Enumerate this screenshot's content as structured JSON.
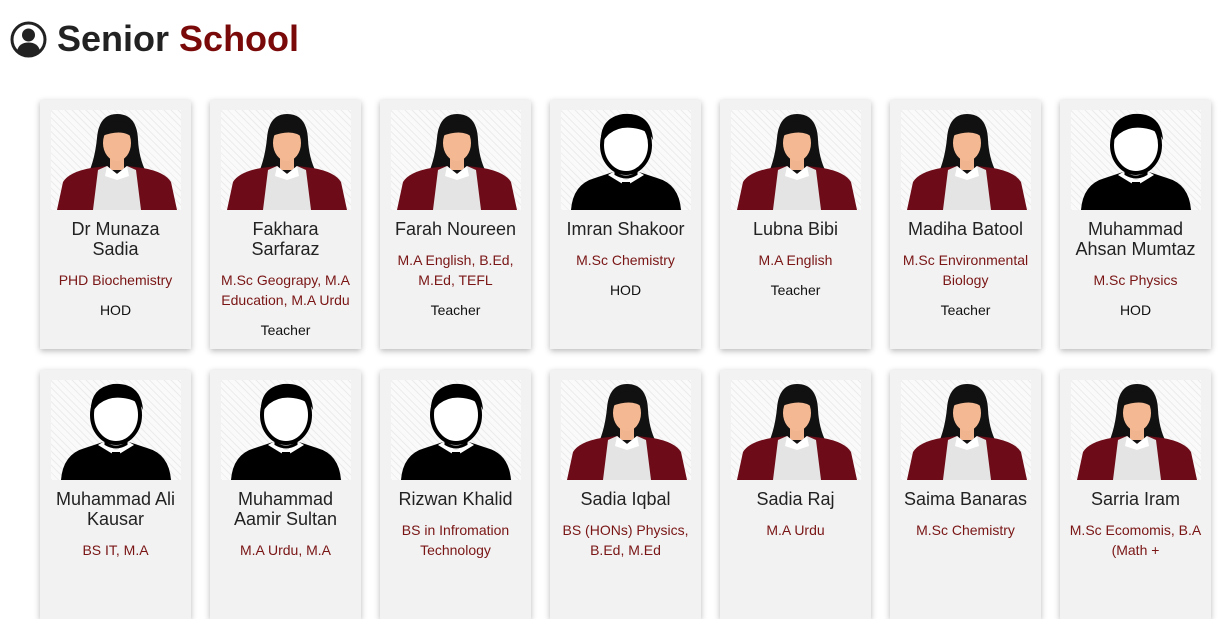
{
  "header": {
    "title_word1": "Senior",
    "title_word2": "School",
    "icon": "user-circle-icon",
    "accent_color": "#7a0a0a"
  },
  "staff": [
    {
      "name": "Dr Munaza Sadia",
      "qualification": "PHD Biochemistry",
      "role": "HOD",
      "avatar": "female-avatar-icon"
    },
    {
      "name": "Fakhara Sarfaraz",
      "qualification": "M.Sc Geograpy, M.A Education, M.A Urdu",
      "role": "Teacher",
      "avatar": "female-avatar-icon"
    },
    {
      "name": "Farah Noureen",
      "qualification": "M.A English, B.Ed, M.Ed, TEFL",
      "role": "Teacher",
      "avatar": "female-avatar-icon"
    },
    {
      "name": "Imran Shakoor",
      "qualification": "M.Sc Chemistry",
      "role": "HOD",
      "avatar": "male-avatar-icon"
    },
    {
      "name": "Lubna Bibi",
      "qualification": "M.A English",
      "role": "Teacher",
      "avatar": "female-avatar-icon"
    },
    {
      "name": "Madiha Batool",
      "qualification": "M.Sc Environmental Biology",
      "role": "Teacher",
      "avatar": "female-avatar-icon"
    },
    {
      "name": "Muhammad Ahsan Mumtaz",
      "qualification": "M.Sc Physics",
      "role": "HOD",
      "avatar": "male-avatar-icon"
    },
    {
      "name": "Muhammad Ali Kausar",
      "qualification": "BS IT, M.A",
      "role": "",
      "avatar": "male-avatar-icon"
    },
    {
      "name": "Muhammad Aamir Sultan",
      "qualification": "M.A Urdu, M.A",
      "role": "",
      "avatar": "male-avatar-icon"
    },
    {
      "name": "Rizwan Khalid",
      "qualification": "BS in Infromation Technology",
      "role": "",
      "avatar": "male-avatar-icon"
    },
    {
      "name": "Sadia Iqbal",
      "qualification": "BS (HONs) Physics, B.Ed, M.Ed",
      "role": "",
      "avatar": "female-avatar-icon"
    },
    {
      "name": "Sadia Raj",
      "qualification": "M.A Urdu",
      "role": "",
      "avatar": "female-avatar-icon"
    },
    {
      "name": "Saima Banaras",
      "qualification": "M.Sc Chemistry",
      "role": "",
      "avatar": "female-avatar-icon"
    },
    {
      "name": "Sarria Iram",
      "qualification": "M.Sc Ecomomis, B.A (Math +",
      "role": "",
      "avatar": "female-avatar-icon"
    }
  ]
}
